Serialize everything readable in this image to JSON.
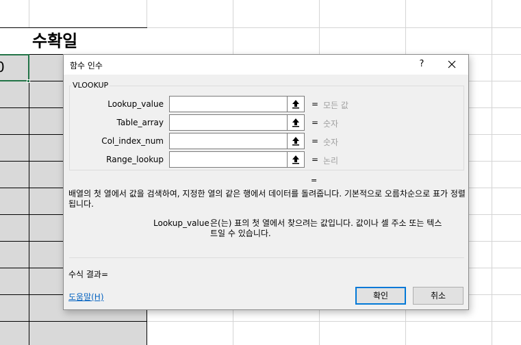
{
  "sheet": {
    "header_text": "수확일",
    "selected_cell_text": "0"
  },
  "dialog": {
    "title": "함수 인수",
    "help_glyph": "?",
    "group_label": "VLOOKUP",
    "arguments": [
      {
        "label": "Lookup_value",
        "value": "",
        "result": "모든 값"
      },
      {
        "label": "Table_array",
        "value": "",
        "result": "숫자"
      },
      {
        "label": "Col_index_num",
        "value": "",
        "result": "숫자"
      },
      {
        "label": "Range_lookup",
        "value": "",
        "result": "논리"
      }
    ],
    "eq_sign": "=",
    "overall_eq": "=",
    "description": "배열의 첫 열에서 값을 검색하여, 지정한 열의 같은 행에서 데이터를 돌려줍니다. 기본적으로 오름차순으로 표가 정렬됩니다.",
    "arg_help_name": "Lookup_value",
    "arg_help_text": "은(는) 표의 첫 열에서 찾으려는 값입니다. 값이나 셀 주소 또는 텍스트일 수 있습니다.",
    "formula_result": "수식 결과=",
    "help_link": "도움말(H)",
    "ok_label": "확인",
    "cancel_label": "취소"
  },
  "colors": {
    "accent": "#0078d7",
    "selection": "#217346",
    "link": "#0563c1",
    "shade": "#d9d9d9"
  }
}
